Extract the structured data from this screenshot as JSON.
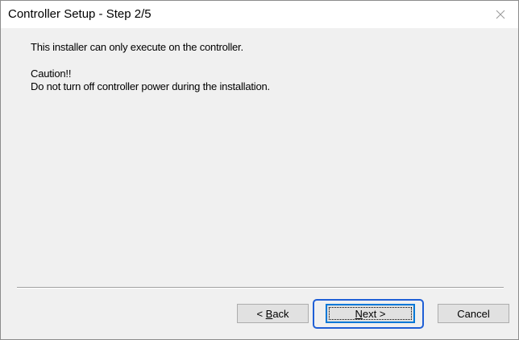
{
  "window": {
    "title": "Controller Setup - Step 2/5",
    "close_icon": "close-icon"
  },
  "message": {
    "line1": "This installer can only execute on the controller.",
    "caution": "Caution!!",
    "warning": "Do not turn off controller power during the installation."
  },
  "buttons": {
    "back_prefix": "< ",
    "back_accel": "B",
    "back_rest": "ack",
    "next_accel": "N",
    "next_rest": "ext >",
    "cancel": "Cancel"
  },
  "colors": {
    "highlight": "#1f5fd6",
    "focus_border": "#0078d7",
    "dialog_bg": "#f0f0f0"
  }
}
